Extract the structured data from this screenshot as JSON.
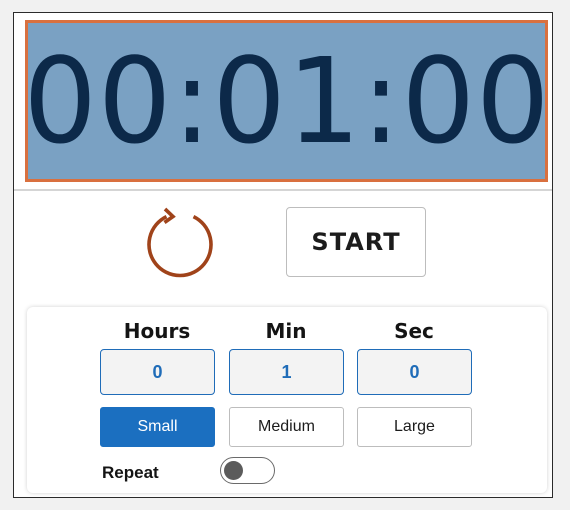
{
  "timer": {
    "display": "00:01:00"
  },
  "controls": {
    "reset_icon": "reset-icon",
    "start_label": "START"
  },
  "fields": {
    "hours_label": "Hours",
    "hours_value": "0",
    "min_label": "Min",
    "min_value": "1",
    "sec_label": "Sec",
    "sec_value": "0"
  },
  "sizes": {
    "small": "Small",
    "medium": "Medium",
    "large": "Large",
    "selected": "Small"
  },
  "repeat": {
    "label": "Repeat",
    "enabled": false
  },
  "colors": {
    "display_bg": "#7aa1c3",
    "display_border": "#d9703f",
    "display_text": "#0c2949",
    "accent": "#1b6fc0",
    "reset_icon": "#a0431a"
  }
}
